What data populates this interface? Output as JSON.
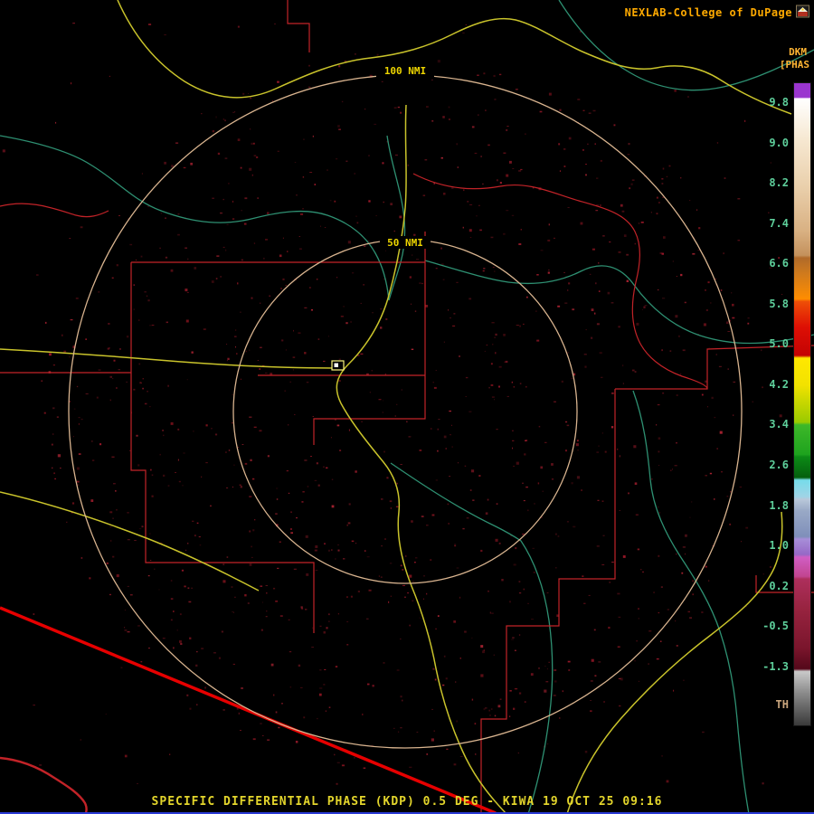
{
  "header": {
    "brand": "NEXLAB-College of DuPage"
  },
  "footer": {
    "title": "SPECIFIC DIFFERENTIAL PHASE (KDP) 0.5 DEG - KIWA 19 OCT 25 09:16"
  },
  "rings": {
    "outer": "100 NMI",
    "inner": "50 NMI"
  },
  "colorbar": {
    "unit": "DKM",
    "scale_label": "[PHAS",
    "bottom_label": "TH",
    "ticks": [
      "9.8",
      "9.0",
      "8.2",
      "7.4",
      "6.6",
      "5.8",
      "5.0",
      "4.2",
      "3.4",
      "2.6",
      "1.8",
      "1.0",
      "0.2",
      "-0.5",
      "-1.3"
    ],
    "gradient": [
      {
        "pos": 0.0,
        "color": "#9a35cf"
      },
      {
        "pos": 2.2,
        "color": "#9a35cf"
      },
      {
        "pos": 2.4,
        "color": "#ffffff"
      },
      {
        "pos": 9.0,
        "color": "#f6e7d0"
      },
      {
        "pos": 16.0,
        "color": "#ead0ac"
      },
      {
        "pos": 23.0,
        "color": "#d9b183"
      },
      {
        "pos": 26.8,
        "color": "#c4915c"
      },
      {
        "pos": 27.2,
        "color": "#b06a2a"
      },
      {
        "pos": 29.6,
        "color": "#cf7a1d"
      },
      {
        "pos": 33.6,
        "color": "#ff8d00"
      },
      {
        "pos": 34.0,
        "color": "#ee4e07"
      },
      {
        "pos": 38.0,
        "color": "#dd0f04"
      },
      {
        "pos": 42.4,
        "color": "#c40303"
      },
      {
        "pos": 42.8,
        "color": "#ffe800"
      },
      {
        "pos": 47.0,
        "color": "#f2e200"
      },
      {
        "pos": 49.4,
        "color": "#ccd800"
      },
      {
        "pos": 52.8,
        "color": "#9aca00"
      },
      {
        "pos": 53.2,
        "color": "#3eb829"
      },
      {
        "pos": 57.8,
        "color": "#1ea31e"
      },
      {
        "pos": 58.2,
        "color": "#0c8a16"
      },
      {
        "pos": 61.4,
        "color": "#04600e"
      },
      {
        "pos": 61.8,
        "color": "#76dcea"
      },
      {
        "pos": 64.4,
        "color": "#a0d4e6"
      },
      {
        "pos": 64.8,
        "color": "#b9c8da"
      },
      {
        "pos": 66.6,
        "color": "#99a9c6"
      },
      {
        "pos": 70.6,
        "color": "#7f8fba"
      },
      {
        "pos": 71.0,
        "color": "#a78ed8"
      },
      {
        "pos": 73.4,
        "color": "#9668c6"
      },
      {
        "pos": 73.8,
        "color": "#d05ec4"
      },
      {
        "pos": 76.8,
        "color": "#c24590"
      },
      {
        "pos": 77.2,
        "color": "#ad2f5c"
      },
      {
        "pos": 82.0,
        "color": "#97233f"
      },
      {
        "pos": 88.0,
        "color": "#7a152c"
      },
      {
        "pos": 91.2,
        "color": "#54081a"
      },
      {
        "pos": 91.6,
        "color": "#c9c9c9"
      },
      {
        "pos": 95.0,
        "color": "#8a8a8a"
      },
      {
        "pos": 100.0,
        "color": "#3a3a3a"
      }
    ]
  },
  "colors": {
    "background": "#000000",
    "brand_text": "#ffaa00",
    "unit_text": "#ffb433",
    "tick_text": "#5ecf9b",
    "th_text": "#c9a57d",
    "title_text": "#e3d52c",
    "bottom_rule": "#2b3bd6",
    "roads": "#c9c32b",
    "counties": "#c22328",
    "rivers": "#2e9072",
    "border": "#e60000",
    "rings": "#d9b48f",
    "ring_label": "#edd500",
    "site_marker": "#fcf77e",
    "echo_palette": [
      "#8e1622",
      "#a3192b",
      "#7c121c",
      "#b02433",
      "#901a28"
    ]
  }
}
